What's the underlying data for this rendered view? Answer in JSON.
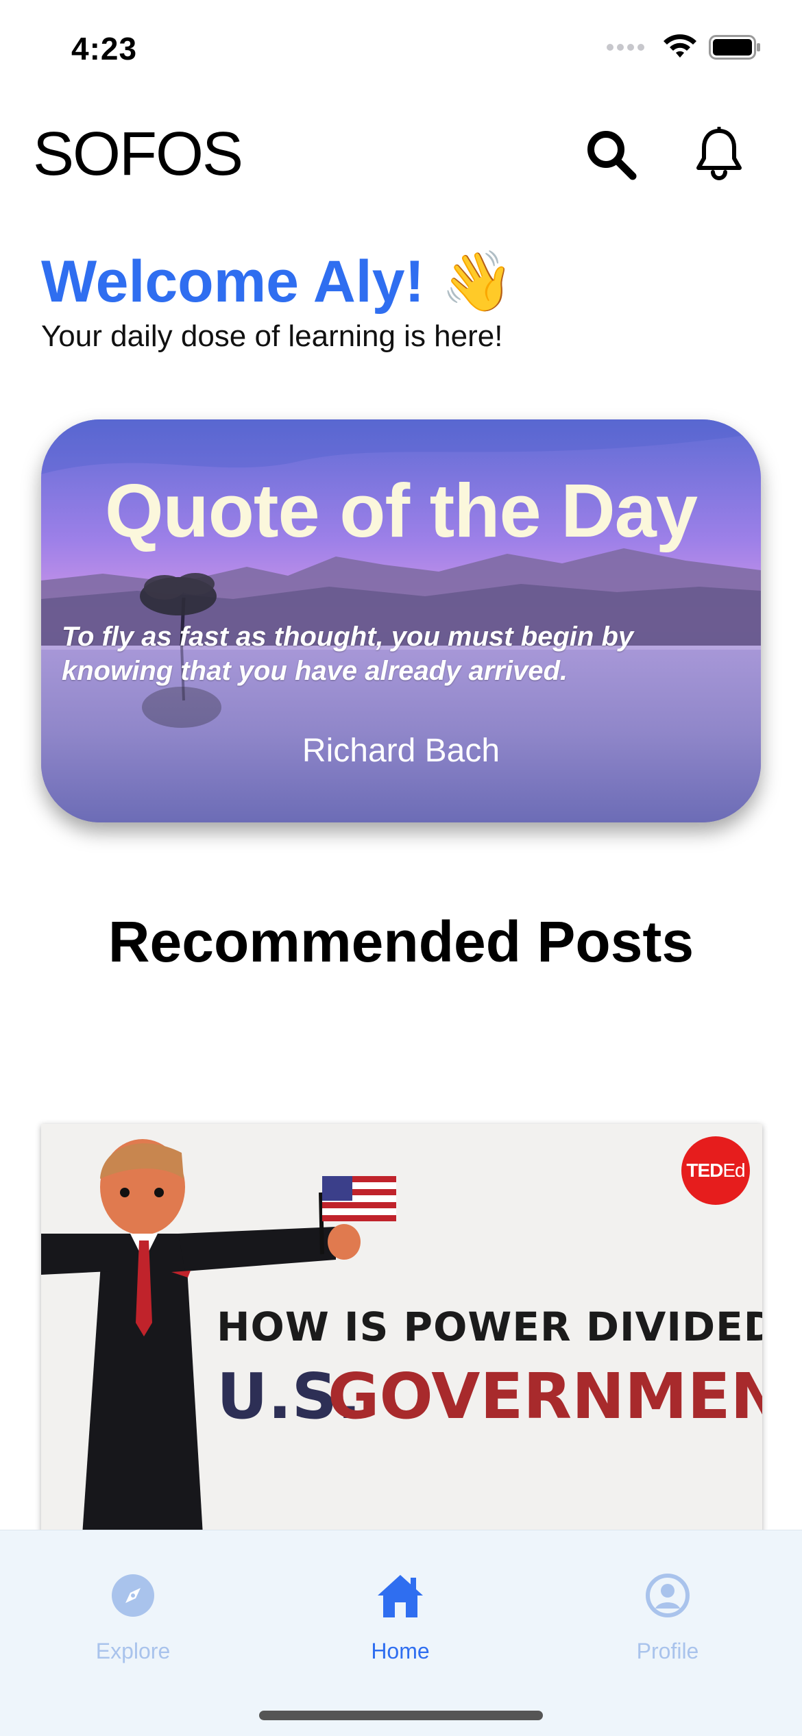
{
  "status_bar": {
    "time": "4:23"
  },
  "header": {
    "app_name": "SOFOS",
    "search_icon": "search-icon",
    "notifications_icon": "bell-icon"
  },
  "welcome": {
    "title": "Welcome Aly! 👋",
    "subtitle": "Your daily dose of learning is here!"
  },
  "quote_card": {
    "heading": "Quote of the Day",
    "text": "To fly as fast as thought, you must begin by knowing that you have already arrived.",
    "author": "Richard Bach"
  },
  "recommended": {
    "title": "Recommended Posts",
    "posts": [
      {
        "title_line1": "HOW IS POWER DIVIDED IN THE",
        "title_part_a": "U.S.",
        "title_part_b": "GOVERNMENT?",
        "badge_main": "TED",
        "badge_sub": "Ed"
      }
    ]
  },
  "tab_bar": {
    "tabs": [
      {
        "label": "Explore",
        "icon": "compass-icon",
        "active": false
      },
      {
        "label": "Home",
        "icon": "home-icon",
        "active": true
      },
      {
        "label": "Profile",
        "icon": "user-circle-icon",
        "active": false
      }
    ]
  },
  "colors": {
    "accent": "#2f6ef0",
    "tab_active": "#2f6ef0",
    "tab_inactive": "#a9c3ec",
    "tab_bar_bg": "#eef5fb",
    "quote_heading": "#fbf7dc",
    "post_red": "#a82a2c",
    "post_navy": "#2d2f55"
  }
}
